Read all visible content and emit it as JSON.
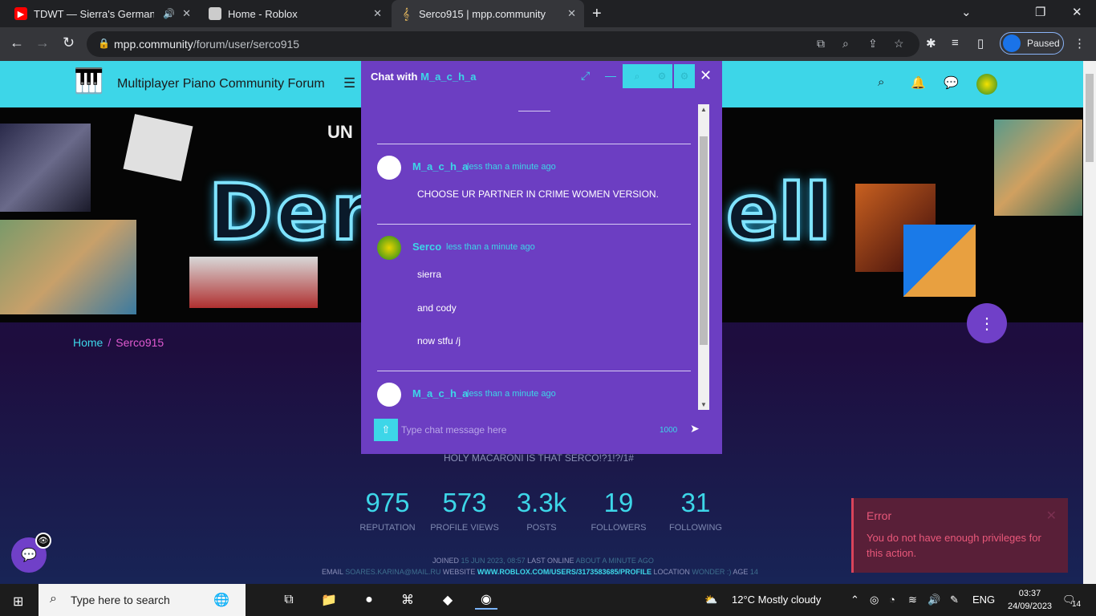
{
  "browser": {
    "tabs": [
      {
        "title": "TDWT — Sierra's German So",
        "favicon": "youtube-icon",
        "audio": true
      },
      {
        "title": "Home - Roblox",
        "favicon": "roblox-icon"
      },
      {
        "title": "Serco915 | mpp.community",
        "favicon": "treble-clef-icon",
        "active": true
      }
    ],
    "url_host": "mpp.community",
    "url_path": "/forum/user/serco915",
    "profile_status": "Paused"
  },
  "site": {
    "title": "Multiplayer Piano Community Forum"
  },
  "cover": {
    "small_text": "UN",
    "neon_left": "Derc",
    "neon_right": "ell"
  },
  "breadcrumb": {
    "home": "Home",
    "sep": "/",
    "current": "Serco915"
  },
  "chat": {
    "header_prefix": "Chat with",
    "partner": "M_a_c_h_a",
    "messages": [
      {
        "author": "M_a_c_h_a",
        "time": "less than a minute ago",
        "lines": [
          "CHOOSE UR PARTNER IN CRIME WOMEN VERSION."
        ]
      },
      {
        "author": "Serco",
        "time": "less than a minute ago",
        "lines": [
          "sierra",
          "and cody",
          "now stfu /j"
        ]
      },
      {
        "author": "M_a_c_h_a",
        "time": "less than a minute ago",
        "lines": []
      }
    ],
    "input_placeholder": "Type chat message here",
    "char_count": "1000"
  },
  "profile": {
    "aboutme": "HOLY MACARONI IS THAT SERCO!?1!?/1#",
    "stats": [
      {
        "value": "975",
        "label": "REPUTATION"
      },
      {
        "value": "573",
        "label": "PROFILE VIEWS"
      },
      {
        "value": "3.3k",
        "label": "POSTS"
      },
      {
        "value": "19",
        "label": "FOLLOWERS"
      },
      {
        "value": "31",
        "label": "FOLLOWING"
      }
    ],
    "joined_label": "JOINED",
    "joined_value": "15 JUN 2023, 08:57",
    "last_online_label": "LAST ONLINE",
    "last_online_value": "ABOUT A MINUTE AGO",
    "email_label": "EMAIL",
    "email_value": "SOARES.KARINA@MAIL.RU",
    "website_label": "WEBSITE",
    "website_value": "WWW.ROBLOX.COM/USERS/3173583685/PROFILE",
    "location_label": "LOCATION",
    "location_value": "WONDER :)",
    "age_label": "AGE",
    "age_value": "14"
  },
  "toast": {
    "title": "Error",
    "message": "You do not have enough privileges for this action."
  },
  "taskbar": {
    "search_placeholder": "Type here to search",
    "weather": "12°C  Mostly cloudy",
    "language": "ENG",
    "time": "03:37",
    "date": "24/09/2023",
    "notifications": "14"
  },
  "colors": {
    "accent": "#3dd6e8",
    "chat_bg": "#6c3ec2",
    "error": "#e9587a"
  }
}
